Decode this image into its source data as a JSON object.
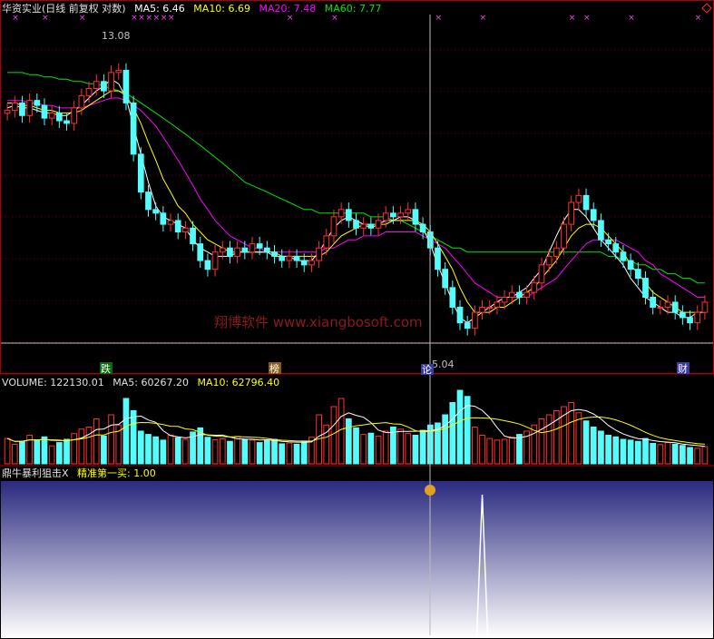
{
  "header": {
    "title": "华资实业(日线 前复权 对数)",
    "ma5_label": "MA5: 6.46",
    "ma10_label": "MA10: 6.69",
    "ma20_label": "MA20: 7.48",
    "ma60_label": "MA60: 7.77"
  },
  "volume_header": {
    "volume_label": "VOLUME: 122130.01",
    "ma5_label": "MA5: 60267.20",
    "ma10_label": "MA10: 62796.40"
  },
  "indicator_header": {
    "name": "鼎牛暴利狙击X",
    "value_label": "精准第一买: 1.00"
  },
  "watermark": "翔博软件 www.xiangbosoft.com",
  "annotations": {
    "high_price": "13.08",
    "low_price": "5.04",
    "tag_die": "跌",
    "tag_bang": "榜",
    "tag_lun": "论",
    "tag_cai": "财"
  },
  "colors": {
    "up": "#ff3232",
    "down": "#54fcfc",
    "ma5": "#ffffff",
    "ma10": "#ffff00",
    "ma20": "#ff00ff",
    "ma60": "#00e600",
    "panel_border": "#aa0000",
    "grid": "#7f0000",
    "indicator_fill_top": "#2a2a80",
    "indicator_fill_bottom": "#ffffff"
  },
  "chart_data": {
    "type": "candlestick",
    "scale": "log",
    "price_close": [
      11.2,
      11.5,
      11.0,
      11.6,
      11.4,
      10.9,
      11.1,
      10.8,
      10.7,
      11.3,
      11.8,
      12.1,
      12.4,
      12.0,
      12.8,
      12.9,
      11.5,
      9.6,
      8.4,
      7.9,
      7.8,
      7.5,
      7.6,
      7.3,
      7.4,
      7.0,
      6.6,
      6.4,
      6.8,
      6.9,
      6.7,
      6.9,
      6.8,
      7.0,
      6.9,
      6.8,
      6.7,
      6.6,
      6.7,
      6.6,
      6.5,
      6.6,
      6.9,
      7.2,
      7.7,
      7.9,
      7.6,
      7.4,
      7.5,
      7.4,
      7.6,
      7.8,
      7.7,
      7.8,
      7.9,
      7.5,
      7.3,
      6.9,
      6.4,
      6.0,
      5.6,
      5.3,
      5.2,
      5.5,
      5.6,
      5.6,
      5.7,
      5.8,
      5.9,
      5.8,
      5.9,
      6.1,
      6.5,
      6.7,
      6.9,
      7.5,
      8.1,
      8.3,
      7.9,
      7.6,
      7.1,
      7.0,
      6.8,
      6.6,
      6.4,
      6.2,
      5.8,
      5.6,
      5.6,
      5.7,
      5.5,
      5.4,
      5.3,
      5.5,
      5.7
    ],
    "ma5": [
      11.3,
      11.4,
      11.3,
      11.3,
      11.2,
      11.1,
      11.1,
      11.0,
      11.0,
      11.2,
      11.4,
      11.7,
      12.0,
      12.2,
      12.5,
      12.3,
      11.7,
      10.6,
      9.6,
      8.7,
      8.0,
      7.7,
      7.6,
      7.5,
      7.4,
      7.1,
      6.9,
      6.8,
      6.7,
      6.7,
      6.7,
      6.8,
      6.8,
      6.8,
      6.8,
      6.8,
      6.7,
      6.7,
      6.7,
      6.6,
      6.6,
      6.6,
      6.8,
      7.1,
      7.4,
      7.6,
      7.7,
      7.6,
      7.5,
      7.4,
      7.5,
      7.6,
      7.6,
      7.7,
      7.7,
      7.6,
      7.4,
      7.0,
      6.5,
      6.1,
      5.7,
      5.4,
      5.3,
      5.4,
      5.5,
      5.6,
      5.7,
      5.8,
      5.8,
      5.9,
      6.0,
      6.2,
      6.4,
      6.8,
      7.2,
      7.6,
      7.9,
      7.9,
      7.7,
      7.4,
      7.1,
      6.9,
      6.7,
      6.5,
      6.2,
      6.0,
      5.8,
      5.7,
      5.6,
      5.5,
      5.5,
      5.4,
      5.4,
      5.5,
      5.5
    ],
    "ma10": [
      11.5,
      11.5,
      11.4,
      11.4,
      11.3,
      11.2,
      11.2,
      11.1,
      11.1,
      11.1,
      11.2,
      11.4,
      11.6,
      11.8,
      12.0,
      12.0,
      11.8,
      11.3,
      10.7,
      10.0,
      9.4,
      8.8,
      8.4,
      8.0,
      7.8,
      7.5,
      7.3,
      7.1,
      7.0,
      6.9,
      6.8,
      6.8,
      6.8,
      6.8,
      6.8,
      6.8,
      6.8,
      6.7,
      6.7,
      6.7,
      6.7,
      6.7,
      6.7,
      6.8,
      7.0,
      7.2,
      7.3,
      7.4,
      7.5,
      7.5,
      7.5,
      7.5,
      7.6,
      7.6,
      7.6,
      7.6,
      7.5,
      7.3,
      7.0,
      6.7,
      6.4,
      6.0,
      5.7,
      5.5,
      5.5,
      5.5,
      5.6,
      5.6,
      5.7,
      5.8,
      5.9,
      6.0,
      6.2,
      6.4,
      6.6,
      6.9,
      7.2,
      7.4,
      7.5,
      7.5,
      7.4,
      7.2,
      7.0,
      6.8,
      6.5,
      6.3,
      6.1,
      5.9,
      5.8,
      5.7,
      5.6,
      5.5,
      5.5,
      5.5,
      5.5
    ],
    "ma20": [
      11.6,
      11.6,
      11.6,
      11.5,
      11.5,
      11.4,
      11.4,
      11.3,
      11.3,
      11.3,
      11.3,
      11.4,
      11.5,
      11.6,
      11.7,
      11.7,
      11.6,
      11.4,
      11.2,
      10.9,
      10.6,
      10.2,
      9.8,
      9.4,
      9.0,
      8.6,
      8.2,
      7.9,
      7.6,
      7.4,
      7.2,
      7.1,
      7.0,
      6.9,
      6.9,
      6.8,
      6.8,
      6.8,
      6.8,
      6.8,
      6.8,
      6.8,
      6.8,
      6.9,
      6.9,
      7.0,
      7.1,
      7.1,
      7.2,
      7.2,
      7.2,
      7.3,
      7.3,
      7.3,
      7.3,
      7.3,
      7.2,
      7.1,
      7.0,
      6.9,
      6.7,
      6.5,
      6.3,
      6.1,
      6.0,
      5.9,
      5.8,
      5.8,
      5.8,
      5.8,
      5.8,
      5.9,
      6.0,
      6.1,
      6.2,
      6.4,
      6.6,
      6.8,
      7.0,
      7.1,
      7.1,
      7.1,
      7.1,
      7.0,
      6.9,
      6.8,
      6.6,
      6.5,
      6.3,
      6.2,
      6.1,
      6.0,
      5.9,
      5.8,
      5.8
    ],
    "ma60": [
      12.8,
      12.8,
      12.8,
      12.7,
      12.7,
      12.6,
      12.6,
      12.5,
      12.5,
      12.4,
      12.4,
      12.3,
      12.3,
      12.2,
      12.1,
      12.0,
      11.9,
      11.7,
      11.5,
      11.3,
      11.1,
      10.9,
      10.7,
      10.5,
      10.3,
      10.1,
      9.9,
      9.7,
      9.5,
      9.3,
      9.1,
      8.9,
      8.7,
      8.6,
      8.5,
      8.4,
      8.3,
      8.2,
      8.1,
      8.0,
      7.9,
      7.9,
      7.8,
      7.8,
      7.8,
      7.8,
      7.8,
      7.8,
      7.8,
      7.7,
      7.7,
      7.7,
      7.6,
      7.6,
      7.5,
      7.4,
      7.3,
      7.2,
      7.1,
      7.0,
      6.9,
      6.9,
      6.8,
      6.8,
      6.8,
      6.8,
      6.8,
      6.8,
      6.8,
      6.8,
      6.8,
      6.8,
      6.8,
      6.8,
      6.8,
      6.8,
      6.8,
      6.8,
      6.8,
      6.8,
      6.8,
      6.7,
      6.7,
      6.6,
      6.6,
      6.5,
      6.5,
      6.4,
      6.4,
      6.3,
      6.3,
      6.2,
      6.2,
      6.1,
      6.1
    ],
    "volume": [
      62,
      48,
      55,
      70,
      58,
      66,
      44,
      52,
      60,
      74,
      85,
      90,
      110,
      68,
      120,
      95,
      160,
      130,
      80,
      72,
      66,
      58,
      70,
      64,
      60,
      78,
      88,
      65,
      59,
      61,
      55,
      67,
      60,
      58,
      52,
      57,
      60,
      49,
      51,
      48,
      55,
      65,
      120,
      95,
      140,
      160,
      110,
      88,
      72,
      75,
      68,
      80,
      90,
      85,
      74,
      70,
      82,
      95,
      100,
      120,
      150,
      180,
      165,
      90,
      70,
      62,
      58,
      60,
      66,
      72,
      80,
      95,
      110,
      120,
      130,
      140,
      150,
      125,
      105,
      90,
      80,
      70,
      66,
      60,
      58,
      55,
      62,
      50,
      47,
      52,
      48,
      45,
      40,
      38,
      42
    ],
    "ylim": [
      4.6,
      15.5
    ],
    "high": 13.08,
    "low": 5.04,
    "indicator": {
      "name": "精准第一买",
      "value": 1.0,
      "signal_index": 64
    }
  }
}
